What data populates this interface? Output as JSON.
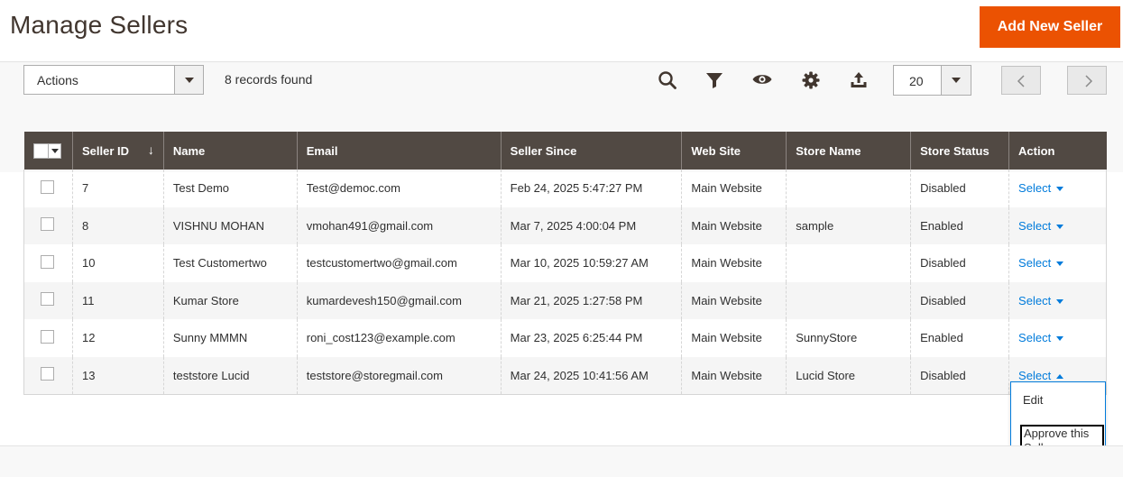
{
  "header": {
    "title": "Manage Sellers",
    "add_button": "Add New Seller"
  },
  "toolbar": {
    "actions_label": "Actions",
    "records_found": "8 records found",
    "per_page": "20",
    "icons": [
      "search-icon",
      "filter-icon",
      "eye-icon",
      "gear-icon",
      "export-icon"
    ]
  },
  "colors": {
    "accent": "#eb5202",
    "header_bg": "#514943",
    "link": "#007bdb"
  },
  "grid": {
    "columns": [
      "Seller ID",
      "Name",
      "Email",
      "Seller Since",
      "Web Site",
      "Store Name",
      "Store Status",
      "Action"
    ],
    "sort_indicator": "↓",
    "rows": [
      {
        "id": "7",
        "name": "Test Demo",
        "email": "Test@democ.com",
        "since": "Feb 24, 2025 5:47:27 PM",
        "website": "Main Website",
        "store": "",
        "status": "Disabled",
        "action": "Select"
      },
      {
        "id": "8",
        "name": "VISHNU MOHAN",
        "email": "vmohan491@gmail.com",
        "since": "Mar 7, 2025 4:00:04 PM",
        "website": "Main Website",
        "store": "sample",
        "status": "Enabled",
        "action": "Select"
      },
      {
        "id": "10",
        "name": "Test Customertwo",
        "email": "testcustomertwo@gmail.com",
        "since": "Mar 10, 2025 10:59:27 AM",
        "website": "Main Website",
        "store": "",
        "status": "Disabled",
        "action": "Select"
      },
      {
        "id": "11",
        "name": "Kumar Store",
        "email": "kumardevesh150@gmail.com",
        "since": "Mar 21, 2025 1:27:58 PM",
        "website": "Main Website",
        "store": "",
        "status": "Disabled",
        "action": "Select"
      },
      {
        "id": "12",
        "name": "Sunny MMMN",
        "email": "roni_cost123@example.com",
        "since": "Mar 23, 2025 6:25:44 PM",
        "website": "Main Website",
        "store": "SunnyStore",
        "status": "Enabled",
        "action": "Select"
      },
      {
        "id": "13",
        "name": "teststore Lucid",
        "email": "teststore@storegmail.com",
        "since": "Mar 24, 2025 10:41:56 AM",
        "website": "Main Website",
        "store": "Lucid Store",
        "status": "Disabled",
        "action": "Select"
      }
    ]
  },
  "action_menu": {
    "edit": "Edit",
    "approve": "Approve this Seller"
  }
}
